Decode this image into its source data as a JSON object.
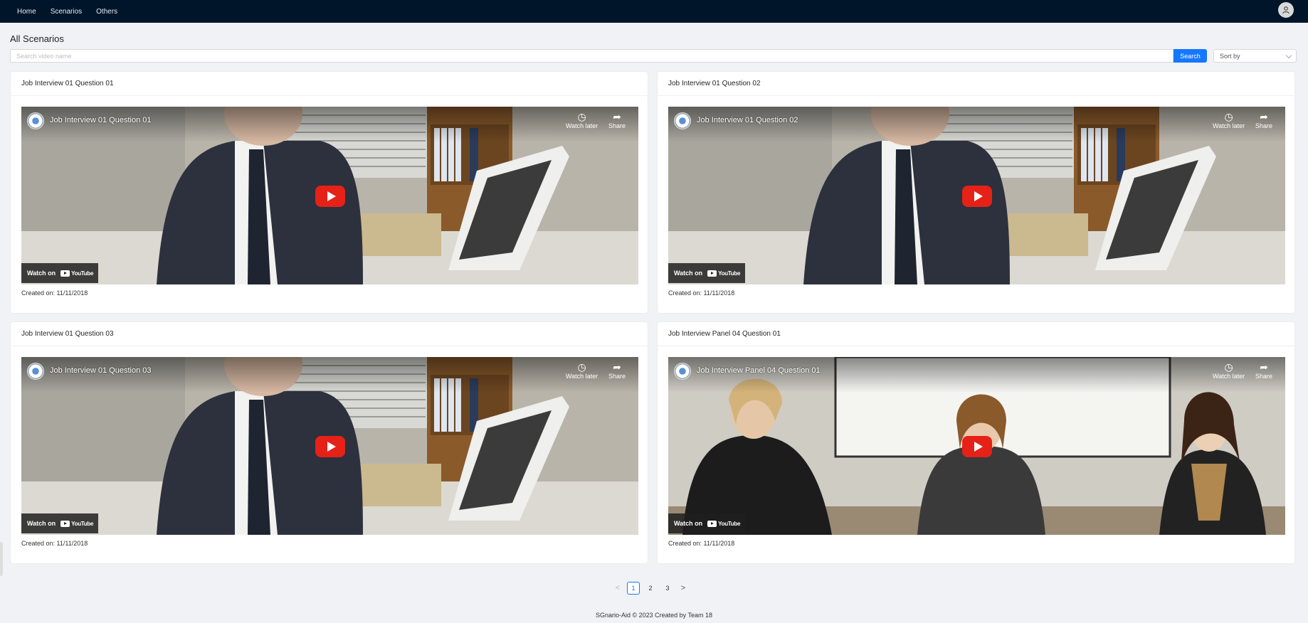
{
  "nav": {
    "items": [
      {
        "label": "Home"
      },
      {
        "label": "Scenarios"
      },
      {
        "label": "Others"
      }
    ]
  },
  "user": {
    "avatar_icon": "user-icon"
  },
  "page": {
    "title": "All Scenarios"
  },
  "search": {
    "placeholder": "Search video name",
    "value": "",
    "button_label": "Search"
  },
  "sort": {
    "label": "Sort by",
    "icon": "chevron-down-icon"
  },
  "cards": [
    {
      "title": "Job Interview 01 Question 01",
      "video_title": "Job Interview 01 Question 01",
      "watch_later": "Watch later",
      "share": "Share",
      "watch_on": "Watch on",
      "youtube": "YouTube",
      "created": "Created on: 11/11/2018",
      "scene": "office"
    },
    {
      "title": "Job Interview 01 Question 02",
      "video_title": "Job Interview 01 Question 02",
      "watch_later": "Watch later",
      "share": "Share",
      "watch_on": "Watch on",
      "youtube": "YouTube",
      "created": "Created on: 11/11/2018",
      "scene": "office"
    },
    {
      "title": "Job Interview 01 Question 03",
      "video_title": "Job Interview 01 Question 03",
      "watch_later": "Watch later",
      "share": "Share",
      "watch_on": "Watch on",
      "youtube": "YouTube",
      "created": "Created on: 11/11/2018",
      "scene": "office"
    },
    {
      "title": "Job Interview Panel 04 Question 01",
      "video_title": "Job Interview Panel 04 Question 01",
      "watch_later": "Watch later",
      "share": "Share",
      "watch_on": "Watch on",
      "youtube": "YouTube",
      "created": "Created on: 11/11/2018",
      "scene": "panel"
    }
  ],
  "pagination": {
    "prev": "<",
    "pages": [
      "1",
      "2",
      "3"
    ],
    "current": "1",
    "next": ">"
  },
  "footer": {
    "text": "SGnario-Aid © 2023 Created by Team 18"
  },
  "colors": {
    "topbar": "#001529",
    "primary": "#1677ff",
    "play": "#e62117"
  }
}
